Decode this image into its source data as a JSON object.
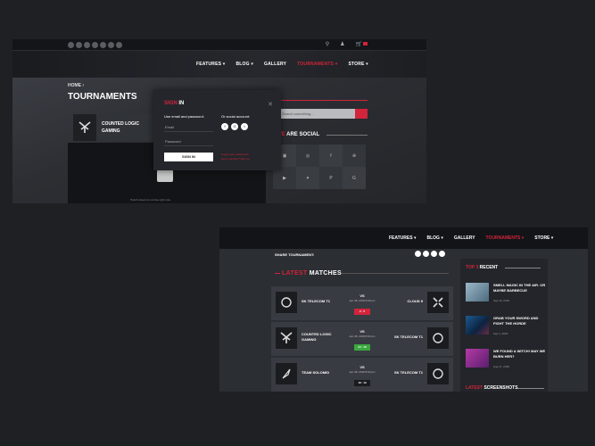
{
  "shot1": {
    "nav": {
      "items": [
        "FEATURES ▾",
        "BLOG ▾",
        "GALLERY",
        "TOURNAMENTS ▾",
        "STORE ▾"
      ],
      "active": 3
    },
    "breadcrumb": "HOME ›",
    "page_title": "TOURNAMENTS",
    "team_name": "COUNTED LOGIC GAMING",
    "stream_message": "Twitch stream is not live right now",
    "search": {
      "placeholder": "Search something..."
    },
    "social_heading": {
      "accent": "WE",
      "rest": " ARE SOCIAL"
    },
    "social_grid": [
      "tw",
      "ig",
      "fb",
      "db",
      "yt",
      "tw",
      "pi",
      "gp"
    ],
    "modal": {
      "title_accent": "SIGN",
      "title_rest": " IN",
      "close": "✕",
      "email_label": "Use email and password:",
      "social_label": "Or social account:",
      "email_placeholder": "Email",
      "password_placeholder": "Password",
      "submit_label": "SIGN IN",
      "forgot": "Forgot your password?",
      "register": "Not a member? Sign up"
    }
  },
  "shot2": {
    "nav": {
      "items": [
        "FEATURES ▾",
        "BLOG ▾",
        "GALLERY",
        "TOURNAMENTS ▾",
        "STORE ▾"
      ],
      "active": 3
    },
    "share_label": "SHARE TOURNAMENT:",
    "latest_heading": {
      "accent": "LATEST",
      "rest": " MATCHES"
    },
    "matches": [
      {
        "team_left": "SK TELECOM T1",
        "team_right": "CLOUD 9",
        "vs": "VS",
        "date": "Apr 28, 2018 8:00 pm",
        "score": "2 : 0",
        "score_color": "#d2243b"
      },
      {
        "team_left": "COUNTED LOGIC GAMING",
        "team_right": "SK TELECOM T1",
        "vs": "VS",
        "date": "Apr 28, 2018 8:00 pm",
        "score": "24 : 16",
        "score_color": "#3aa93e"
      },
      {
        "team_left": "TEAM SOLOMID",
        "team_right": "SK TELECOM T1",
        "vs": "VS",
        "date": "Apr 28, 2018 8:00 pm",
        "score": "18 : 19",
        "score_color": "#1a1b1f"
      }
    ],
    "top3_heading": {
      "accent": "TOP 3",
      "rest": " RECENT"
    },
    "posts": [
      {
        "title": "SMELL MAGIC IN THE AIR. OR MAYBE BARBECUE",
        "date": "Sep 16, 2018"
      },
      {
        "title": "GRAB YOUR SWORD AND FIGHT THE HORDE",
        "date": "Sep 1, 2018"
      },
      {
        "title": "WE FOUND A WITCH! MAY WE BURN HER?",
        "date": "Aug 27, 2018"
      }
    ],
    "screenshots_heading": {
      "accent": "LATEST",
      "rest": " SCREENSHOTS"
    }
  }
}
